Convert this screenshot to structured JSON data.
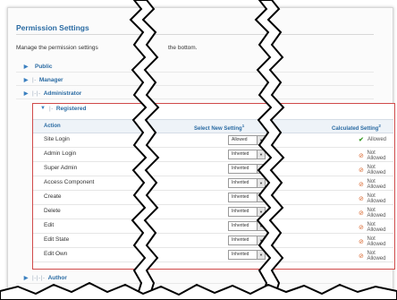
{
  "panel": {
    "title": "Permission Settings",
    "description_left": "Manage the permission settings",
    "description_right": "the bottom."
  },
  "groups_top": [
    {
      "label": "Public",
      "prefix": ""
    },
    {
      "label": "Manager",
      "prefix": "|-"
    },
    {
      "label": "Administrator",
      "prefix": "|-|-"
    }
  ],
  "registered": {
    "label": "Registered",
    "prefix": "|-",
    "headers": {
      "action": "Action",
      "select": "Select New Setting",
      "select_note": "1",
      "calculated": "Calculated Setting",
      "calculated_note": "2"
    },
    "rows": [
      {
        "action": "Site Login",
        "setting": "Allowed",
        "calculated": "Allowed",
        "calc_icon": "check-icon"
      },
      {
        "action": "Admin Login",
        "setting": "Inherited",
        "calculated": "Not Allowed",
        "calc_icon": "not-allowed-icon"
      },
      {
        "action": "Super Admin",
        "setting": "Inherited",
        "calculated": "Not Allowed",
        "calc_icon": "not-allowed-icon"
      },
      {
        "action": "Access Component",
        "setting": "Inherited",
        "calculated": "Not Allowed",
        "calc_icon": "not-allowed-icon"
      },
      {
        "action": "Create",
        "setting": "Inherited",
        "calculated": "Not Allowed",
        "calc_icon": "not-allowed-icon"
      },
      {
        "action": "Delete",
        "setting": "Inherited",
        "calculated": "Not Allowed",
        "calc_icon": "not-allowed-icon"
      },
      {
        "action": "Edit",
        "setting": "Inherited",
        "calculated": "Not Allowed",
        "calc_icon": "not-allowed-icon"
      },
      {
        "action": "Edit State",
        "setting": "Inherited",
        "calculated": "Not Allowed",
        "calc_icon": "not-allowed-icon"
      },
      {
        "action": "Edit Own",
        "setting": "Inherited",
        "calculated": "Not Allowed",
        "calc_icon": "not-allowed-icon"
      }
    ]
  },
  "groups_bottom": [
    {
      "label": "Author",
      "prefix": "|-|-|-"
    }
  ],
  "colors": {
    "link_blue": "#2a6ba3",
    "highlight_border": "#d04a4a",
    "allowed_green": "#3a9a2a",
    "not_allowed_orange": "#d8652c"
  },
  "icons": {
    "expand": "triangle-right-icon",
    "collapse": "triangle-down-icon",
    "select_arrow": "dropdown-arrow-icon"
  }
}
